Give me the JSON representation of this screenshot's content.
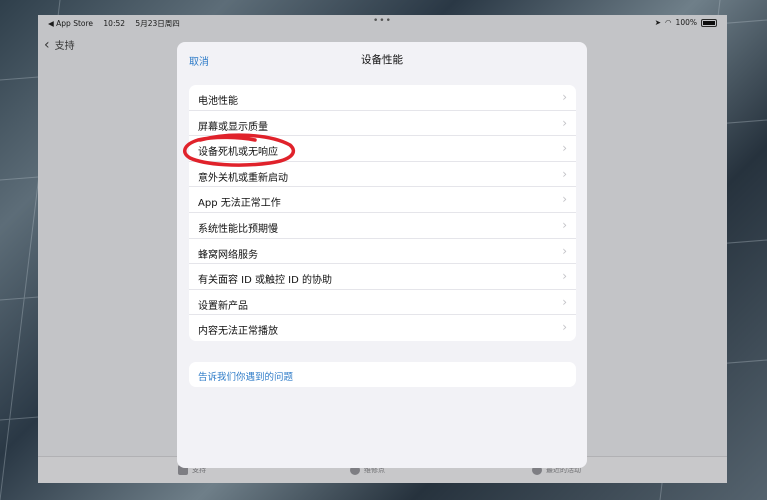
{
  "status_bar": {
    "back_app": "◀ App Store",
    "time": "10:52",
    "date": "5月23日周四",
    "dots": "•••",
    "battery": "100%"
  },
  "nav": {
    "back_label": "支持"
  },
  "sheet": {
    "cancel": "取消",
    "title": "设备性能",
    "items": [
      {
        "label": "电池性能"
      },
      {
        "label": "屏幕或显示质量"
      },
      {
        "label": "设备死机或无响应"
      },
      {
        "label": "意外关机或重新启动"
      },
      {
        "label": "App 无法正常工作"
      },
      {
        "label": "系统性能比预期慢"
      },
      {
        "label": "蜂窝网络服务"
      },
      {
        "label": "有关面容 ID 或触控 ID 的协助"
      },
      {
        "label": "设置新产品"
      },
      {
        "label": "内容无法正常播放"
      }
    ],
    "tell_us": "告诉我们你遇到的问题"
  },
  "tabbar": {
    "tab1": "支持",
    "tab2": "维修点",
    "tab3": "最近的活动"
  },
  "colors": {
    "accent": "#2f7cc8",
    "annotation": "#e0222b"
  }
}
